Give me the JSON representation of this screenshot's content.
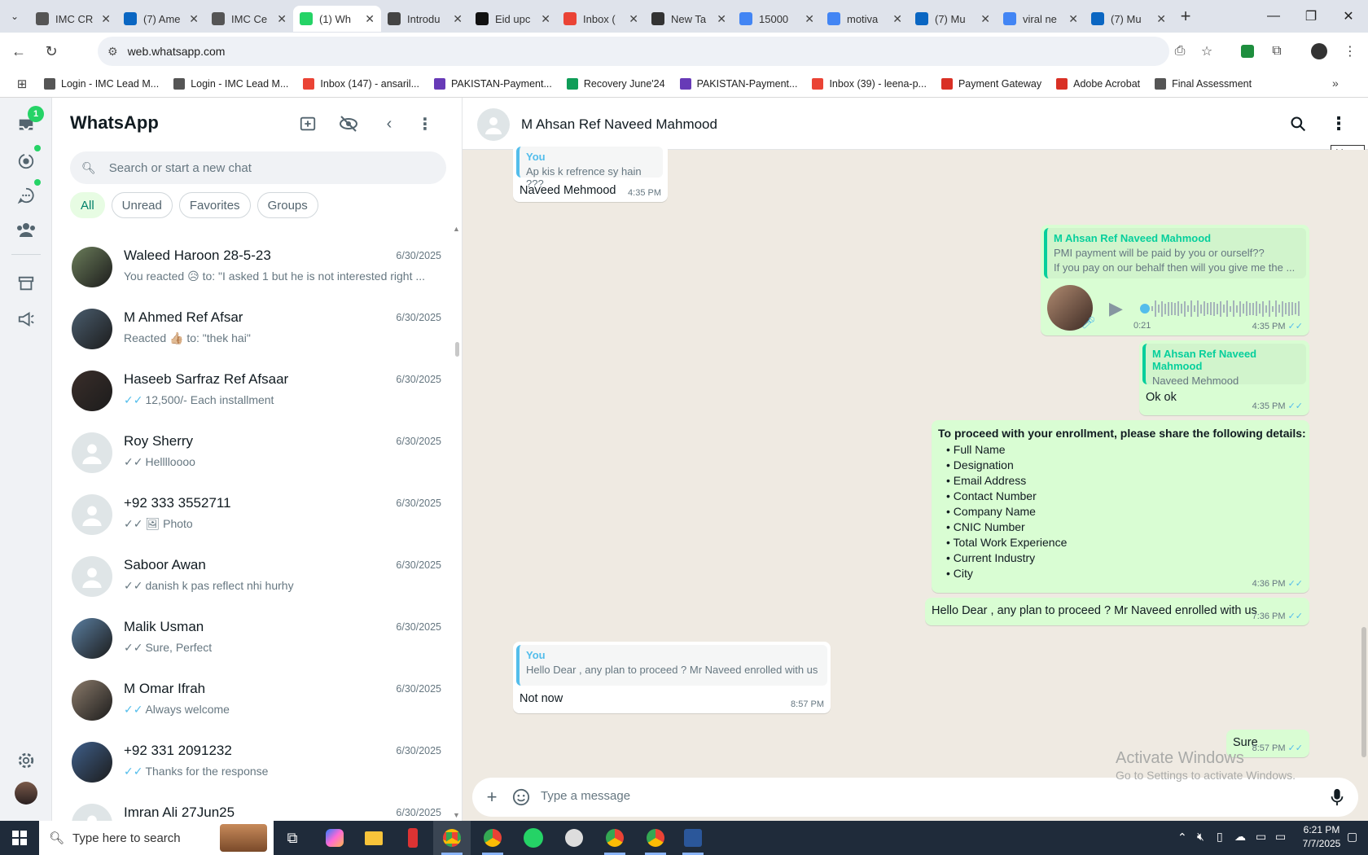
{
  "browser": {
    "tabs": [
      {
        "title": "IMC CR",
        "fav": "rick",
        "color": "#555"
      },
      {
        "title": "(7) Ame",
        "fav": "in",
        "color": "#0a66c2"
      },
      {
        "title": "IMC Ce",
        "fav": "rick",
        "color": "#555"
      },
      {
        "title": "(1) Wh",
        "fav": "wa",
        "color": "#25d366",
        "active": true
      },
      {
        "title": "Introdu",
        "fav": "openai",
        "color": "#444"
      },
      {
        "title": "Eid upc",
        "fav": "threads",
        "color": "#111"
      },
      {
        "title": "Inbox (",
        "fav": "gmail",
        "color": "#ea4335"
      },
      {
        "title": "New Ta",
        "fav": "chrome",
        "color": "#333"
      },
      {
        "title": "15000",
        "fav": "g",
        "color": "#4285f4"
      },
      {
        "title": "motiva",
        "fav": "g",
        "color": "#4285f4"
      },
      {
        "title": "(7) Mu",
        "fav": "in",
        "color": "#0a66c2"
      },
      {
        "title": "viral ne",
        "fav": "g",
        "color": "#4285f4"
      },
      {
        "title": "(7) Mu",
        "fav": "in",
        "color": "#0a66c2"
      }
    ],
    "url": "web.whatsapp.com",
    "bookmarks": [
      {
        "label": "Login - IMC Lead M...",
        "color": "#555"
      },
      {
        "label": "Login - IMC Lead M...",
        "color": "#555"
      },
      {
        "label": "Inbox (147) - ansaril...",
        "color": "#ea4335"
      },
      {
        "label": "PAKISTAN-Payment...",
        "color": "#673ab7"
      },
      {
        "label": "Recovery June'24",
        "color": "#0f9d58"
      },
      {
        "label": "PAKISTAN-Payment...",
        "color": "#673ab7"
      },
      {
        "label": "Inbox (39) - leena-p...",
        "color": "#ea4335"
      },
      {
        "label": "Payment Gateway",
        "color": "#d93025"
      },
      {
        "label": "Adobe Acrobat",
        "color": "#d93025"
      },
      {
        "label": "Final Assessment",
        "color": "#555"
      }
    ]
  },
  "whatsapp": {
    "app_title": "WhatsApp",
    "unread_badge": "1",
    "search_placeholder": "Search or start a new chat",
    "filters": [
      "All",
      "Unread",
      "Favorites",
      "Groups"
    ],
    "chats": [
      {
        "name": "Waleed Haroon 28-5-23",
        "time": "6/30/2025",
        "preview": "You reacted 😥 to: \"I asked 1 but he is not interested right ...",
        "tick": "",
        "photo": true
      },
      {
        "name": "M Ahmed Ref Afsar",
        "time": "6/30/2025",
        "preview": "Reacted 👍🏼 to: \"thek hai\"",
        "tick": "",
        "photo": true
      },
      {
        "name": "Haseeb Sarfraz Ref Afsaar",
        "time": "6/30/2025",
        "preview": "12,500/-  Each installment",
        "tick": "blue",
        "photo": true
      },
      {
        "name": "Roy Sherry",
        "time": "6/30/2025",
        "preview": "Helllloooo",
        "tick": "grey",
        "photo": false
      },
      {
        "name": "+92 333 3552711",
        "time": "6/30/2025",
        "preview": "🖼 Photo",
        "tick": "grey",
        "photo": false
      },
      {
        "name": "Saboor Awan",
        "time": "6/30/2025",
        "preview": "danish k pas reflect nhi hurhy",
        "tick": "grey",
        "photo": false
      },
      {
        "name": "Malik Usman",
        "time": "6/30/2025",
        "preview": "Sure, Perfect",
        "tick": "grey",
        "photo": true
      },
      {
        "name": "M Omar Ifrah",
        "time": "6/30/2025",
        "preview": "Always welcome",
        "tick": "blue",
        "photo": true
      },
      {
        "name": "+92 331 2091232",
        "time": "6/30/2025",
        "preview": "Thanks for the response",
        "tick": "blue",
        "photo": true
      },
      {
        "name": "Imran Ali 27Jun25",
        "time": "6/30/2025",
        "preview": "",
        "tick": "",
        "photo": false
      }
    ],
    "conversation": {
      "contact_name": "M Ahsan Ref Naveed Mahmood",
      "tooltip": "Menu",
      "m1": {
        "quote_name": "You",
        "quote_text": "Ap kis k refrence sy hain ???",
        "text": "Naveed Mehmood",
        "time": "4:35 PM"
      },
      "m2": {
        "quote_name": "M Ahsan Ref Naveed Mahmood",
        "quote_line1": "PMI payment will be paid by you or ourself??",
        "quote_line2": "If you pay on our behalf then will you give me the ...",
        "voice_duration": "0:21",
        "time": "4:35 PM"
      },
      "m3": {
        "quote_name": "M Ahsan Ref Naveed Mahmood",
        "quote_text": "Naveed Mehmood",
        "text": "Ok ok",
        "time": "4:35 PM"
      },
      "m4": {
        "heading": "To proceed with your enrollment, please share the following details:",
        "items": [
          "Full Name",
          "Designation",
          "Email Address",
          "Contact Number",
          "Company Name",
          "CNIC Number",
          "Total Work Experience",
          "Current Industry",
          "City"
        ],
        "time": "4:36 PM"
      },
      "m5": {
        "text": "Hello Dear , any plan to proceed ? Mr Naveed enrolled with  us",
        "time": "7:36 PM"
      },
      "m6": {
        "quote_name": "You",
        "quote_text": "Hello Dear , any plan to proceed ? Mr Naveed enrolled with  us",
        "text": "Not now",
        "time": "8:57 PM"
      },
      "m7": {
        "text": "Sure",
        "time": "8:57 PM"
      }
    },
    "compose_placeholder": "Type a message"
  },
  "watermark": {
    "line1": "Activate Windows",
    "line2": "Go to Settings to activate Windows."
  },
  "taskbar": {
    "search_placeholder": "Type here to search",
    "time": "6:21 PM",
    "date": "7/7/2025"
  }
}
